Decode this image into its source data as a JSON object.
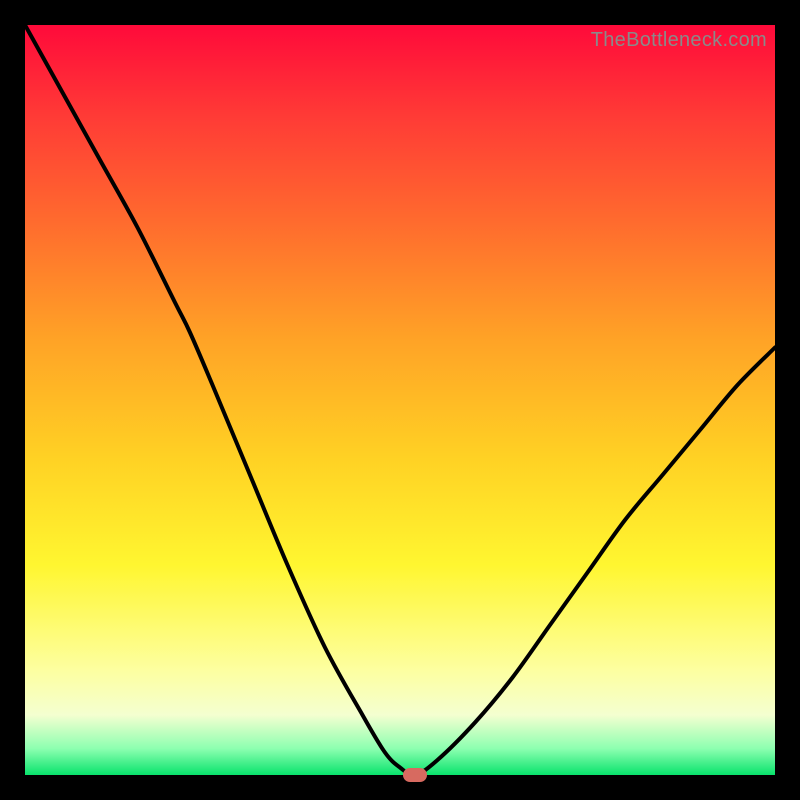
{
  "watermark": "TheBottleneck.com",
  "colors": {
    "frame": "#000000",
    "gradient_top": "#ff0a3a",
    "gradient_bottom": "#09e36c",
    "curve": "#000000",
    "marker": "#d76a60"
  },
  "chart_data": {
    "type": "line",
    "title": "",
    "xlabel": "",
    "ylabel": "",
    "xlim": [
      0,
      100
    ],
    "ylim": [
      0,
      100
    ],
    "grid": false,
    "series": [
      {
        "name": "bottleneck-curve",
        "x": [
          0,
          5,
          10,
          15,
          20,
          22,
          25,
          30,
          35,
          40,
          45,
          48,
          50,
          52,
          55,
          60,
          65,
          70,
          75,
          80,
          85,
          90,
          95,
          100
        ],
        "y": [
          100,
          91,
          82,
          73,
          63,
          59,
          52,
          40,
          28,
          17,
          8,
          3,
          1,
          0,
          2,
          7,
          13,
          20,
          27,
          34,
          40,
          46,
          52,
          57
        ]
      }
    ],
    "marker": {
      "x": 52,
      "y": 0
    },
    "annotations": []
  }
}
